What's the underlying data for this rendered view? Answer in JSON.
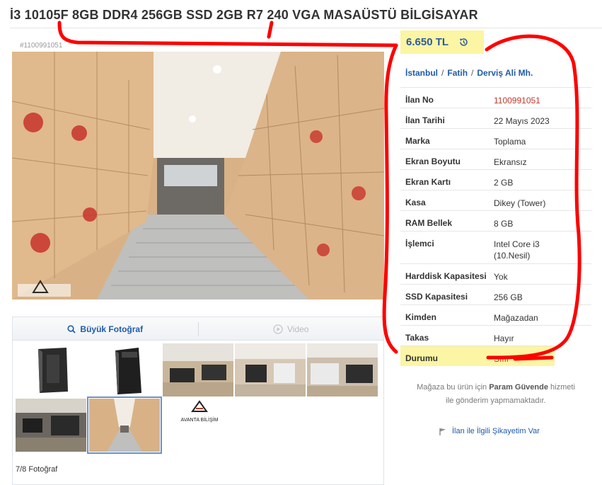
{
  "title": "İ3 10105F 8GB DDR4 256GB SSD 2GB R7 240 VGA MASAÜSTÜ BİLGİSAYAR",
  "classified_id": "#1100991051",
  "price": "6.650 TL",
  "location": {
    "city": "İstanbul",
    "district": "Fatih",
    "neighborhood": "Derviş Ali Mh."
  },
  "details": [
    {
      "label": "İlan No",
      "value": "1100991051"
    },
    {
      "label": "İlan Tarihi",
      "value": "22 Mayıs 2023"
    },
    {
      "label": "Marka",
      "value": "Toplama"
    },
    {
      "label": "Ekran Boyutu",
      "value": "Ekransız"
    },
    {
      "label": "Ekran Kartı",
      "value": "2 GB"
    },
    {
      "label": "Kasa",
      "value": "Dikey (Tower)"
    },
    {
      "label": "RAM Bellek",
      "value": "8 GB"
    },
    {
      "label": "İşlemci",
      "value": "Intel Core i3",
      "value2": "(10.Nesil)"
    },
    {
      "label": "Harddisk Kapasitesi",
      "value": "Yok"
    },
    {
      "label": "SSD Kapasitesi",
      "value": "256 GB"
    },
    {
      "label": "Kimden",
      "value": "Mağazadan"
    },
    {
      "label": "Takas",
      "value": "Hayır"
    },
    {
      "label": "Durumu",
      "value": "Sıfır"
    }
  ],
  "photo_actions": {
    "big_photo": "Büyük Fotoğraf",
    "video": "Video"
  },
  "photo_count": "7/8 Fotoğraf",
  "store_note": {
    "part1": "Mağaza bu ürün için",
    "brand": "Param Güvende",
    "part2": "hizmeti",
    "line2": "ile gönderim yapmamaktadır."
  },
  "complaint": "İlan ile İlgili Şikayetim Var",
  "logo_text": "AVANTA BİLİŞİM",
  "colors": {
    "link": "#1f5ba8",
    "highlight": "#fbf5a4",
    "red_value": "#c0392b",
    "annotation": "#ff0000"
  }
}
